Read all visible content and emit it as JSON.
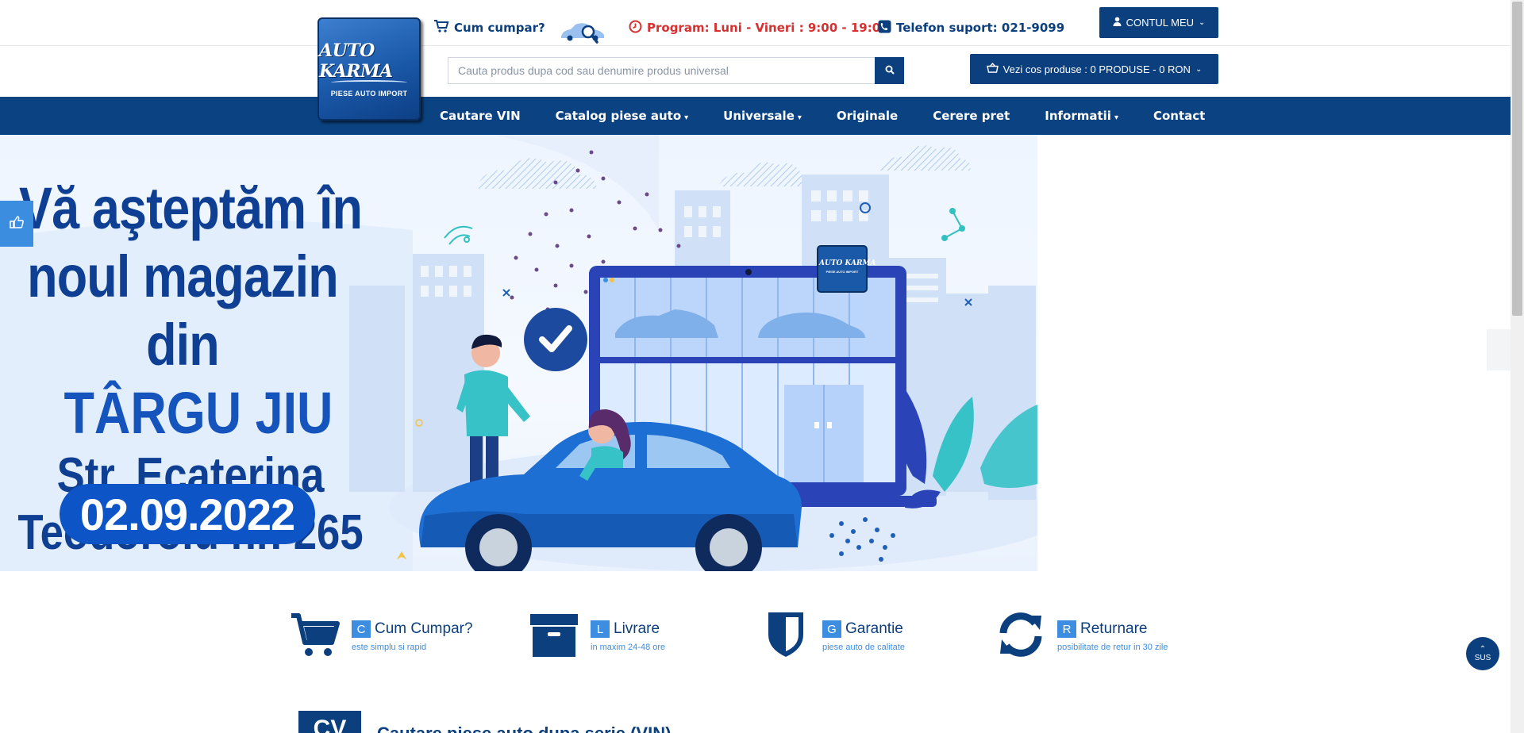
{
  "header": {
    "logo": {
      "brand": "AUTO KARMA",
      "tagline": "PIESE AUTO IMPORT"
    },
    "how_to_buy": "Cum cumpar?",
    "schedule": "Program: Luni - Vineri : 9:00 - 19:00",
    "phone": "Telefon suport: 021-9099",
    "account_label": "CONTUL MEU",
    "search": {
      "placeholder": "Cauta produs dupa cod sau denumire produs universal"
    },
    "cart_label": "Vezi cos produse : 0 PRODUSE - 0 RON"
  },
  "nav": {
    "items": [
      {
        "label": "Cautare VIN",
        "dropdown": false
      },
      {
        "label": "Catalog piese auto",
        "dropdown": true
      },
      {
        "label": "Universale",
        "dropdown": true
      },
      {
        "label": "Originale",
        "dropdown": false
      },
      {
        "label": "Cerere pret",
        "dropdown": false
      },
      {
        "label": "Informatii",
        "dropdown": true
      },
      {
        "label": "Contact",
        "dropdown": false
      }
    ]
  },
  "banner": {
    "line1": "Vă aşteptăm în",
    "line2": "noul magazin din",
    "line3": "TÂRGU JIU",
    "line4": "Str. Ecaterina",
    "line5": "Teodoroiu nr. 265",
    "date": "02.09.2022",
    "screen_logo": "AUTO KARMA",
    "screen_logo_sub": "PIESE AUTO IMPORT"
  },
  "features": [
    {
      "letter": "C",
      "title": "Cum Cumpar?",
      "subtitle": "este simplu si rapid",
      "icon": "cart-icon"
    },
    {
      "letter": "L",
      "title": "Livrare",
      "subtitle": "in maxim 24-48 ore",
      "icon": "box-icon"
    },
    {
      "letter": "G",
      "title": "Garantie",
      "subtitle": "piese auto de calitate",
      "icon": "shield-icon"
    },
    {
      "letter": "R",
      "title": "Returnare",
      "subtitle": "posibilitate de retur in 30 zile",
      "icon": "refresh-icon"
    }
  ],
  "scroll_top_label": "SUS",
  "vin_section": {
    "badge": "CV",
    "title": "Cautare piese auto dupa serie (VIN)"
  },
  "colors": {
    "primary": "#0b3f7e",
    "nav_bg": "#0b4382",
    "accent": "#3d8ee0",
    "alert": "#d63030"
  }
}
